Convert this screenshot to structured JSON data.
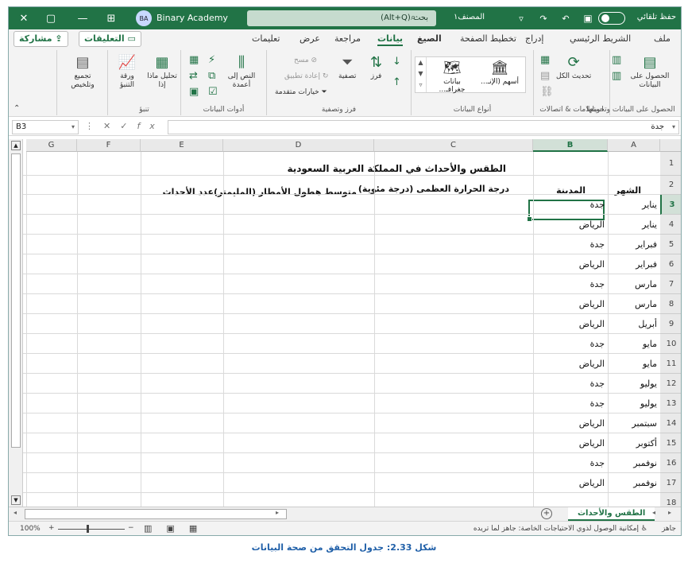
{
  "titlebar": {
    "user": "Binary Academy",
    "avatar": "BA",
    "search_placeholder": "بحث (Alt+Q)",
    "doc_name": "المصنف١",
    "autosave": "حفظ تلقائي",
    "bg_color": "#217346"
  },
  "tabs": [
    "ملف",
    "الشريط الرئيسي",
    "إدراج",
    "تخطيط الصفحة",
    "الصيغ",
    "بيانات",
    "مراجعة",
    "عرض",
    "تعليمات"
  ],
  "active_tab": "بيانات",
  "actions": {
    "comments": "التعليقات",
    "share": "مشاركة"
  },
  "ribbon": {
    "groups": {
      "get_data": "الحصول على البيانات وتحويلها",
      "queries": "استعلامات & اتصالات",
      "data_types": "أنواع البيانات",
      "sort_filter": "فرز وتصفية",
      "data_tools": "أدوات البيانات",
      "forecast": "تنبؤ",
      "outline": ""
    },
    "buttons": {
      "get_data": "الحصول على البيانات",
      "refresh_all": "تحديث الكل",
      "stocks": "أسهم (الإنـ...",
      "geography": "بيانات جغرافـ...",
      "sort": "فرز",
      "filter": "تصفية",
      "clear": "مسح",
      "reapply": "إعادة تطبيق",
      "advanced": "خيارات متقدمة",
      "text_to_columns": "النص إلى أعمدة",
      "what_if": "تحليل ماذا إذا",
      "forecast_sheet": "ورقة التنبؤ",
      "outline": "تجميع وتلخيص"
    }
  },
  "formula_bar": {
    "name_box": "B3",
    "value": "جدة"
  },
  "columns": [
    "A",
    "B",
    "C",
    "D",
    "E",
    "F",
    "G"
  ],
  "selected_column": "B",
  "selected_row": 3,
  "rows": [
    1,
    2,
    3,
    4,
    5,
    6,
    7,
    8,
    9,
    10,
    11,
    12,
    13,
    14,
    15,
    16,
    17,
    18
  ],
  "sheet": {
    "title": "الطقس والأحداث في المملكة العربية السعودية",
    "headers": {
      "A": "الشهر",
      "B": "المدينة",
      "C": "درجة الحرارة العظمى (درجة مئوية)",
      "D": "متوسط هطول الأمطار (المليمتر)",
      "E": "عدد الأحداث"
    },
    "data": [
      {
        "month": "يناير",
        "city": "جدة"
      },
      {
        "month": "يناير",
        "city": "الرياض"
      },
      {
        "month": "فبراير",
        "city": "جدة"
      },
      {
        "month": "فبراير",
        "city": "الرياض"
      },
      {
        "month": "مارس",
        "city": "جدة"
      },
      {
        "month": "مارس",
        "city": "الرياض"
      },
      {
        "month": "أبريل",
        "city": "الرياض"
      },
      {
        "month": "مايو",
        "city": "جدة"
      },
      {
        "month": "مايو",
        "city": "الرياض"
      },
      {
        "month": "يوليو",
        "city": "جدة"
      },
      {
        "month": "يوليو",
        "city": "جدة"
      },
      {
        "month": "سبتمبر",
        "city": "الرياض"
      },
      {
        "month": "أكتوبر",
        "city": "الرياض"
      },
      {
        "month": "نوفمبر",
        "city": "جدة"
      },
      {
        "month": "نوفمبر",
        "city": "الرياض"
      }
    ]
  },
  "sheet_tab": "الطقس والأحداث",
  "status": {
    "ready": "جاهز",
    "accessibility": "إمكانية الوصول لذوي الاحتياجات الخاصة: جاهز لما تريده",
    "zoom": "100%"
  },
  "caption": "شكل 2.33: جدول التحقق من صحة البيانات"
}
